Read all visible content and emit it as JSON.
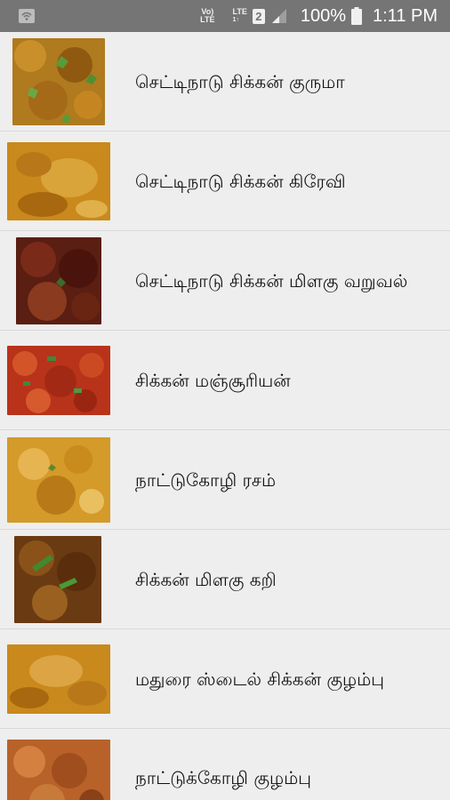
{
  "status_bar": {
    "volte_label": "Vo)\nLTE",
    "lte_label": "LTE",
    "sim_number": "2",
    "battery_percent": "100%",
    "time": "1:11 PM"
  },
  "recipes": [
    {
      "title": "செட்டிநாடு சிக்கன் குருமா"
    },
    {
      "title": "செட்டிநாடு சிக்கன் கிரேவி"
    },
    {
      "title": "செட்டிநாடு சிக்கன் மிளகு வறுவல்"
    },
    {
      "title": "சிக்கன் மஞ்சூரியன்"
    },
    {
      "title": "நாட்டுகோழி ரசம்"
    },
    {
      "title": "சிக்கன் மிளகு கறி"
    },
    {
      "title": "மதுரை ஸ்டைல் சிக்கன் குழம்பு"
    },
    {
      "title": "நாட்டுக்கோழி குழம்பு"
    }
  ]
}
